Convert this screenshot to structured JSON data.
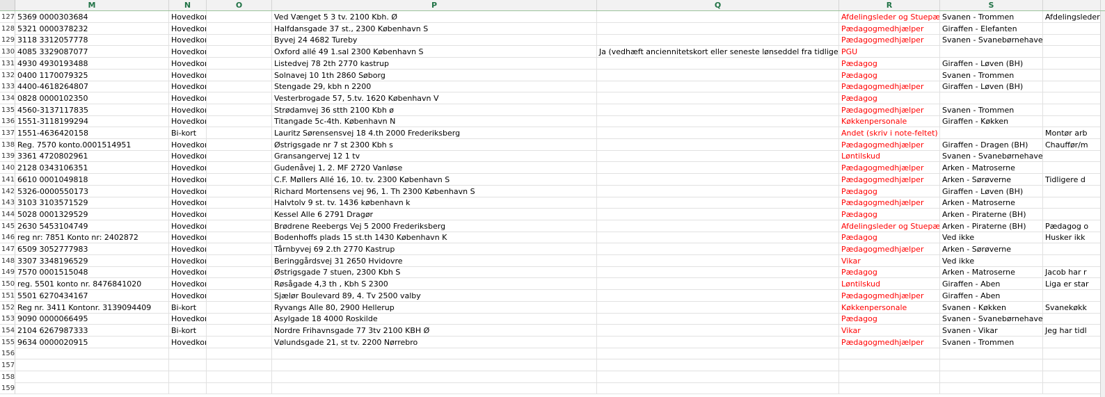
{
  "columns": [
    "M",
    "N",
    "O",
    "P",
    "Q",
    "R",
    "S",
    ""
  ],
  "rows": [
    {
      "num": "127",
      "m": "5369  0000303684",
      "n": "Hovedkort",
      "p": "Ved Vænget 5 3 tv. 2100 Kbh. Ø",
      "q": "",
      "r": "Afdelingsleder og Stuepædagog",
      "s": "Svanen - Trommen",
      "t": "Afdelingsleder"
    },
    {
      "num": "128",
      "m": "5321 0000378232",
      "n": "Hovedkort",
      "p": "Halfdansgade 37 st., 2300 København S",
      "q": "",
      "r": "Pædagogmedhjælper",
      "s": "Giraffen - Elefanten",
      "t": ""
    },
    {
      "num": "129",
      "m": "3118 3312057778",
      "n": "Hovedkort",
      "p": "Byvej 24    4682 Tureby",
      "q": "",
      "r": "Pædagogmedhjælper",
      "s": "Svanen - Svanebørnehaven (BH)",
      "t": ""
    },
    {
      "num": "130",
      "m": "4085 3329087077",
      "n": "Hovedkort",
      "p": "Oxford allé 49 1.sal    2300 København S",
      "q": "Ja (vedhæft anciennitetskort eller seneste lønseddel fra tidligere",
      "r": "PGU",
      "s": "",
      "t": ""
    },
    {
      "num": "131",
      "m": "4930 4930193488",
      "n": "Hovedkort",
      "p": "Listedvej 78 2th 2770 kastrup",
      "q": "",
      "r": "Pædagog",
      "s": "Giraffen - Løven (BH)",
      "t": ""
    },
    {
      "num": "132",
      "m": "0400 1170079325",
      "n": "Hovedkort",
      "p": "Solnavej 10 1th    2860 Søborg",
      "q": "",
      "r": "Pædagog",
      "s": "Svanen - Trommen",
      "t": ""
    },
    {
      "num": "133",
      "m": "4400-4618264807",
      "n": "Hovedkort",
      "p": "Stengade 29, kbh n 2200",
      "q": "",
      "r": "Pædagogmedhjælper",
      "s": "Giraffen - Løven (BH)",
      "t": ""
    },
    {
      "num": "134",
      "m": "0828 0000102350",
      "n": "Hovedkort",
      "p": "Vesterbrogade 57, 5.tv.    1620 København V",
      "q": "",
      "r": "Pædagog",
      "s": "",
      "t": ""
    },
    {
      "num": "135",
      "m": "4560-3137117835",
      "n": "Hovedkort",
      "p": "Strødamvej 36 stth 2100 Kbh ø",
      "q": "",
      "r": "Pædagogmedhjælper",
      "s": "Svanen - Trommen",
      "t": ""
    },
    {
      "num": "136",
      "m": "1551-3118199294",
      "n": "Hovedkort",
      "p": "Titangade 5c-4th. København N",
      "q": "",
      "r": "Køkkenpersonale",
      "s": "Giraffen - Køkken",
      "t": ""
    },
    {
      "num": "137",
      "m": "1551-4636420158",
      "n": "Bi-kort",
      "p": "Lauritz Sørensensvej 18 4.th    2000 Frederiksberg",
      "q": "",
      "r": "Andet (skriv i note-feltet)",
      "s": "",
      "t": "Montør arb"
    },
    {
      "num": "138",
      "m": "Reg. 7570 konto.0001514951",
      "n": "Hovedkort",
      "p": "Østrigsgade nr 7 st    2300 Kbh s",
      "q": "",
      "r": "Pædagogmedhjælper",
      "s": "Giraffen - Dragen (BH)",
      "t": "Chauffør/m"
    },
    {
      "num": "139",
      "m": "3361 4720802961",
      "n": "Hovedkort",
      "p": "Gransangervej 12 1 tv",
      "q": "",
      "r": "Løntilskud",
      "s": "Svanen - Svanebørnehaven (BH)",
      "t": ""
    },
    {
      "num": "140",
      "m": "2128 0343106351",
      "n": "Hovedkort",
      "p": "Gudenåvej 1, 2. MF    2720 Vanløse",
      "q": "",
      "r": "Pædagogmedhjælper",
      "s": "Arken - Matroserne",
      "t": ""
    },
    {
      "num": "141",
      "m": "6610 0001049818",
      "n": "Hovedkort",
      "p": "C.F. Møllers Allé 16, 10. tv.    2300 København S",
      "q": "",
      "r": "Pædagogmedhjælper",
      "s": "Arken - Sørøverne",
      "t": "Tidligere d"
    },
    {
      "num": "142",
      "m": "5326-0000550173",
      "n": "Hovedkort",
      "p": "Richard Mortensens vej 96, 1. Th    2300 København S",
      "q": "",
      "r": "Pædagog",
      "s": "Giraffen - Løven (BH)",
      "t": ""
    },
    {
      "num": "143",
      "m": "3103 3103571529",
      "n": "Hovedkort",
      "p": "Halvtolv 9 st. tv. 1436 københavn k",
      "q": "",
      "r": "Pædagogmedhjælper",
      "s": "Arken - Matroserne",
      "t": ""
    },
    {
      "num": "144",
      "m": "5028 0001329529",
      "n": "Hovedkort",
      "p": "Kessel Alle 6    2791 Dragør",
      "q": "",
      "r": "Pædagog",
      "s": "Arken - Piraterne (BH)",
      "t": ""
    },
    {
      "num": "145",
      "m": "2630 5453104749",
      "n": "Hovedkort",
      "p": "Brødrene Reebergs Vej 5    2000 Frederiksberg",
      "q": "",
      "r": "Afdelingsleder og Stuepædagog",
      "s": "Arken - Piraterne (BH)",
      "t": "Pædagog o"
    },
    {
      "num": "146",
      "m": "reg nr: 7851 Konto nr: 2402872",
      "n": "Hovedkort",
      "p": "Bodenhoffs plads 15 st.th    1430    København K",
      "q": "",
      "r": "Pædagog",
      "s": "Ved ikke",
      "t": "Husker ikk"
    },
    {
      "num": "147",
      "m": "6509 3052777983",
      "n": "Hovedkort",
      "p": "Tårnbyvej 69 2.th    2770 Kastrup",
      "q": "",
      "r": "Pædagogmedhjælper",
      "s": "Arken - Sørøverne",
      "t": ""
    },
    {
      "num": "148",
      "m": "3307 3348196529",
      "n": "Hovedkort",
      "p": "Beringgårdsvej 31    2650 Hvidovre",
      "q": "",
      "r": "Vikar",
      "s": "Ved ikke",
      "t": ""
    },
    {
      "num": "149",
      "m": "7570 0001515048",
      "n": "Hovedkort",
      "p": "Østrigsgade 7 stuen, 2300 Kbh S",
      "q": "",
      "r": "Pædagog",
      "s": "Arken - Matroserne",
      "t": "Jacob har r"
    },
    {
      "num": "150",
      "m": "reg. 5501 konto nr. 8476841020",
      "n": "Hovedkort",
      "p": "Røsågade 4,3 th , Kbh S 2300",
      "q": "",
      "r": "Løntilskud",
      "s": "Giraffen - Aben",
      "t": "Liga er star"
    },
    {
      "num": "151",
      "m": "5501 6270434167",
      "n": "Hovedkort",
      "p": "Sjælør Boulevard 89, 4. Tv    2500 valby",
      "q": "",
      "r": "Pædagogmedhjælper",
      "s": "Giraffen - Aben",
      "t": ""
    },
    {
      "num": "152",
      "m": "Reg nr. 3411 Kontonr. 3139094409",
      "n": "Bi-kort",
      "p": "Ryvangs Alle 80, 2900 Hellerup",
      "q": "",
      "r": "Køkkenpersonale",
      "s": "Svanen - Køkken",
      "t": "Svanekøkk"
    },
    {
      "num": "153",
      "m": "9090 0000066495",
      "n": "Hovedkort",
      "p": "Asylgade 18    4000 Roskilde",
      "q": "",
      "r": "Pædagog",
      "s": "Svanen - Svanebørnehaven (BH)",
      "t": ""
    },
    {
      "num": "154",
      "m": "2104 6267987333",
      "n": "Bi-kort",
      "p": "Nordre Frihavnsgade 77 3tv 2100 KBH Ø",
      "q": "",
      "r": "Vikar",
      "s": "Svanen - Vikar",
      "t": "Jeg har tidl"
    },
    {
      "num": "155",
      "m": "9634 0000020915",
      "n": "Hovedkort",
      "p": "Vølundsgade 21, st tv. 2200 Nørrebro",
      "q": "",
      "r": "Pædagogmedhjælper",
      "s": "Svanen - Trommen",
      "t": ""
    },
    {
      "num": "156",
      "m": "",
      "n": "",
      "p": "",
      "q": "",
      "r": "",
      "s": "",
      "t": ""
    },
    {
      "num": "157",
      "m": "",
      "n": "",
      "p": "",
      "q": "",
      "r": "",
      "s": "",
      "t": ""
    },
    {
      "num": "158",
      "m": "",
      "n": "",
      "p": "",
      "q": "",
      "r": "",
      "s": "",
      "t": ""
    },
    {
      "num": "159",
      "m": "",
      "n": "",
      "p": "",
      "q": "",
      "r": "",
      "s": "",
      "t": ""
    }
  ],
  "colors": {
    "header_text": "#217346",
    "role_text": "#ff0000"
  }
}
